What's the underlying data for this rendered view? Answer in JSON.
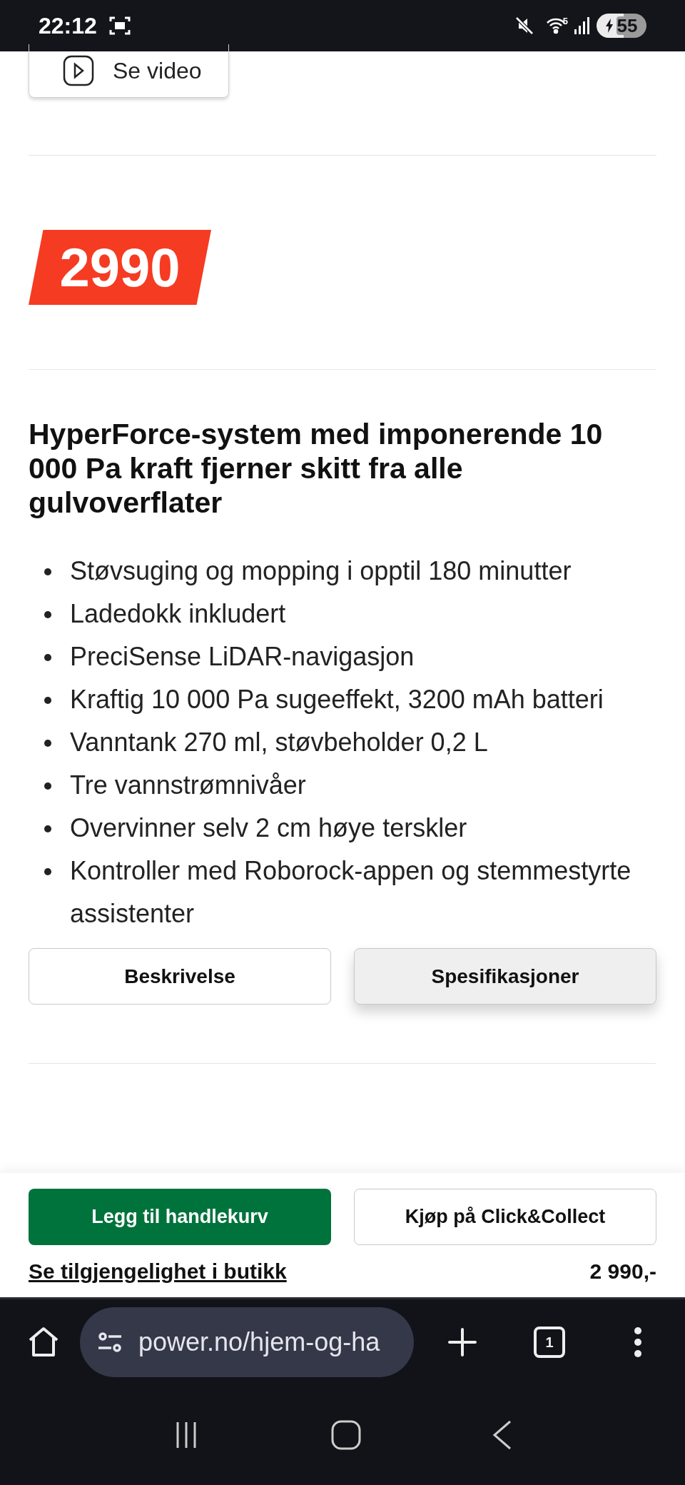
{
  "status_bar": {
    "time": "22:12",
    "network_badge": "5",
    "battery": "55"
  },
  "video_button": {
    "label": "Se video"
  },
  "price_badge": "2990",
  "heading": "HyperForce-system med imponerende 10 000 Pa kraft fjerner skitt fra alle gulvoverflater",
  "features": [
    "Støvsuging og mopping i opptil 180 minutter",
    "Ladedokk inkludert",
    "PreciSense LiDAR-navigasjon",
    "Kraftig 10 000 Pa sugeeffekt, 3200 mAh batteri",
    "Vanntank 270 ml, støvbeholder 0,2 L",
    "Tre vannstrømnivåer",
    "Overvinner selv 2 cm høye terskler",
    "Kontroller med Roborock-appen og stemmestyrte assistenter"
  ],
  "tabs": [
    {
      "label": "Beskrivelse",
      "selected": false
    },
    {
      "label": "Spesifikasjoner",
      "selected": true
    }
  ],
  "purchase_bar": {
    "add_to_cart": "Legg til handlekurv",
    "click_collect": "Kjøp på Click&Collect",
    "store_link": "Se tilgjengelighet i butikk",
    "price": "2 990,-"
  },
  "browser": {
    "url": "power.no/hjem-og-ha",
    "tab_count": "1"
  }
}
